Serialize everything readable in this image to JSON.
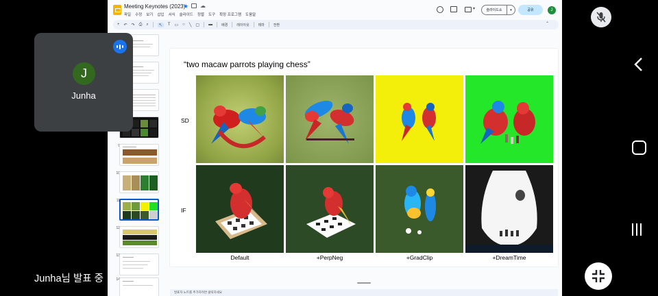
{
  "app": {
    "doc_title": "Meeting Keynotes (2023)",
    "menu": [
      "파일",
      "수정",
      "보기",
      "삽입",
      "서식",
      "슬라이드",
      "정렬",
      "도구",
      "확장 프로그램",
      "도움말"
    ],
    "slideshow_label": "슬라이드쇼",
    "share_label": "공유",
    "user_initial": "J",
    "toolbar_labels": [
      "배경",
      "레이아웃",
      "테마",
      "전환"
    ]
  },
  "filmstrip": {
    "numbers": [
      "9",
      "10",
      "11",
      "12",
      "13",
      "14"
    ],
    "selected": "11"
  },
  "slide": {
    "title": "“two macaw parrots playing chess”",
    "row_labels": [
      "SD",
      "IF"
    ],
    "col_labels": [
      "Default",
      "+PerpNeg",
      "+GradClip",
      "+DreamTime"
    ],
    "notes_placeholder": "발표자 노트를 추가하려면 클릭하세요"
  },
  "meeting": {
    "participant_name": "Junha",
    "participant_initial": "J",
    "presenting_text": "Junha님 발표 중"
  },
  "icons": [
    "star-icon",
    "history-icon",
    "comment-icon",
    "meet-icon",
    "mic-off-icon",
    "back-icon",
    "home-icon",
    "recents-icon",
    "exit-fullscreen-icon",
    "speaking-indicator-icon"
  ],
  "colors": {
    "accent": "#0b57d0",
    "share_bg": "#c2e7ff",
    "tile_bg": "#3c4043",
    "avatar_bg": "#33691e"
  }
}
